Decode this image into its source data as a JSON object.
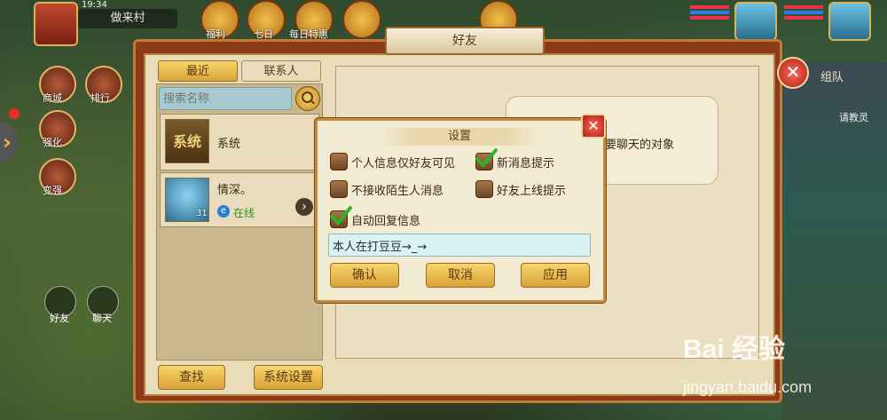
{
  "hud": {
    "time": "19:34",
    "village": "做来村",
    "icons": [
      "福利",
      "七日",
      "每日特惠"
    ]
  },
  "side_menu": [
    {
      "label": "商城"
    },
    {
      "label": "排行"
    },
    {
      "label": "强化"
    },
    {
      "label": "变强"
    }
  ],
  "bottom_bar": [
    {
      "label": "好友"
    },
    {
      "label": "聊天"
    }
  ],
  "right_side": {
    "team_label": "组队",
    "hint": "请教灵"
  },
  "friends_panel": {
    "title": "好友",
    "tabs": [
      {
        "label": "最近"
      },
      {
        "label": "联系人"
      }
    ],
    "search_placeholder": "搜索名称",
    "contacts": [
      {
        "name": "系统",
        "avatar_text": "系统"
      },
      {
        "name": "情深。",
        "level": "31",
        "status": "在线"
      }
    ],
    "find_button": "查找",
    "settings_button": "系统设置",
    "chat_hint": "要聊天的对象"
  },
  "settings_dialog": {
    "title": "设置",
    "options": [
      {
        "label": "个人信息仅好友可见",
        "checked": false
      },
      {
        "label": "新消息提示",
        "checked": true
      },
      {
        "label": "不接收陌生人消息",
        "checked": false
      },
      {
        "label": "好友上线提示",
        "checked": false
      },
      {
        "label": "自动回复信息",
        "checked": true
      }
    ],
    "auto_reply_value": "本人在打豆豆→_→",
    "confirm_button": "确认",
    "cancel_button": "取消",
    "apply_button": "应用"
  },
  "watermark": {
    "main": "Bai 经验",
    "sub": "jingyan.baidu.com"
  }
}
